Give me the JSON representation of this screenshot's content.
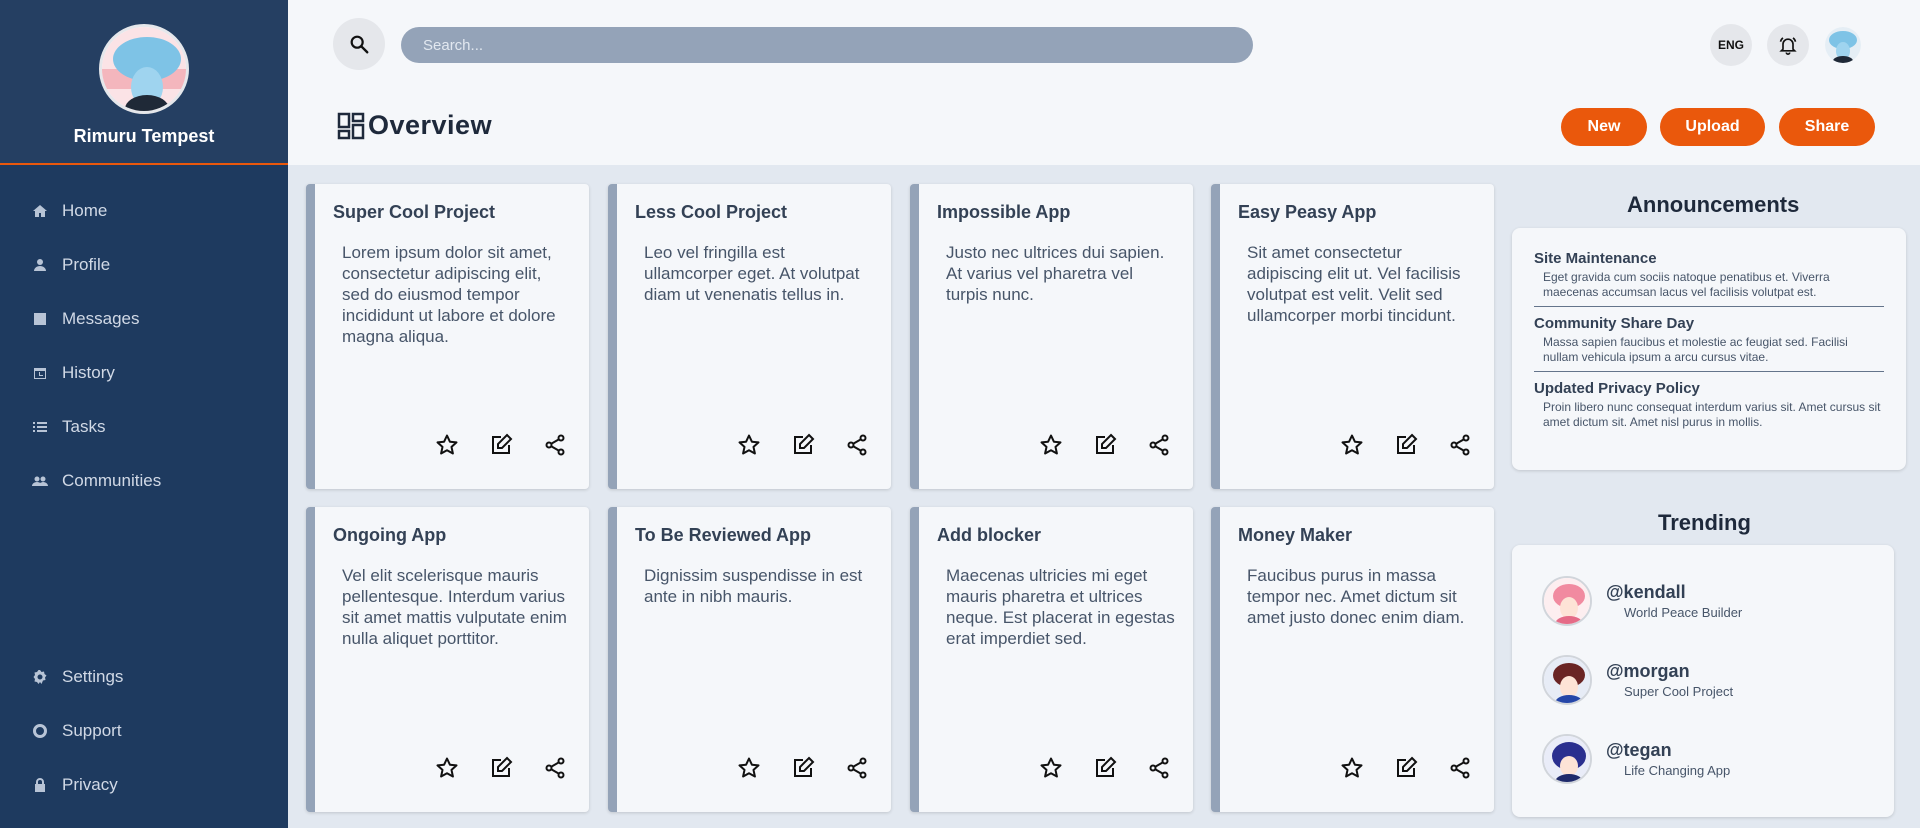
{
  "sidebar": {
    "user_name": "Rimuru Tempest",
    "nav": [
      {
        "label": "Home",
        "icon": "home-icon"
      },
      {
        "label": "Profile",
        "icon": "person-icon"
      },
      {
        "label": "Messages",
        "icon": "inbox-icon"
      },
      {
        "label": "History",
        "icon": "history-icon"
      },
      {
        "label": "Tasks",
        "icon": "list-icon"
      },
      {
        "label": "Communities",
        "icon": "group-icon"
      }
    ],
    "nav_bottom": [
      {
        "label": "Settings",
        "icon": "gear-icon"
      },
      {
        "label": "Support",
        "icon": "support-icon"
      },
      {
        "label": "Privacy",
        "icon": "lock-icon"
      }
    ]
  },
  "header": {
    "search_placeholder": "Search...",
    "lang": "ENG",
    "title": "Overview",
    "buttons": {
      "new": "New",
      "upload": "Upload",
      "share": "Share"
    }
  },
  "cards": [
    {
      "title": "Super Cool Project",
      "desc": "Lorem ipsum dolor sit amet, consectetur adipiscing elit, sed do eiusmod tempor incididunt ut labore et dolore magna aliqua."
    },
    {
      "title": "Less Cool Project",
      "desc": "Leo vel fringilla est ullamcorper eget. At volutpat diam ut venenatis tellus in."
    },
    {
      "title": "Impossible App",
      "desc": "Justo nec ultrices dui sapien. At varius vel pharetra vel turpis nunc."
    },
    {
      "title": "Easy Peasy App",
      "desc": "Sit amet consectetur adipiscing elit ut. Vel facilisis volutpat est velit. Velit sed ullamcorper morbi tincidunt."
    },
    {
      "title": "Ongoing App",
      "desc": "Vel elit scelerisque mauris pellentesque. Interdum varius sit amet mattis vulputate enim nulla aliquet porttitor."
    },
    {
      "title": "To Be Reviewed App",
      "desc": "Dignissim suspendisse in est ante in nibh mauris."
    },
    {
      "title": "Add blocker",
      "desc": "Maecenas ultricies mi eget mauris pharetra et ultrices neque. Est placerat in egestas erat imperdiet sed."
    },
    {
      "title": "Money Maker",
      "desc": "Faucibus purus in massa tempor nec. Amet dictum sit amet justo donec enim diam."
    }
  ],
  "announcements": {
    "title": "Announcements",
    "items": [
      {
        "title": "Site Maintenance",
        "text": "Eget gravida cum sociis natoque penatibus et. Viverra maecenas accumsan lacus vel facilisis volutpat est."
      },
      {
        "title": "Community Share Day",
        "text": "Massa sapien faucibus et molestie ac feugiat sed. Facilisi nullam vehicula ipsum a arcu cursus vitae."
      },
      {
        "title": "Updated Privacy Policy",
        "text": "Proin libero nunc consequat interdum varius sit. Amet cursus sit amet dictum sit. Amet nisl purus in mollis."
      }
    ]
  },
  "trending": {
    "title": "Trending",
    "items": [
      {
        "handle": "@kendall",
        "project": "World Peace Builder"
      },
      {
        "handle": "@morgan",
        "project": "Super Cool Project"
      },
      {
        "handle": "@tegan",
        "project": "Life Changing App"
      }
    ]
  },
  "colors": {
    "accent": "#ea580c",
    "sidebar": "#1e3a5f",
    "card_border": "#94a3b8"
  }
}
